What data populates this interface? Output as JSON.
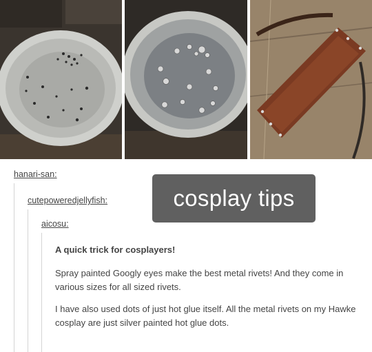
{
  "thread": {
    "user1": "hanari-san:",
    "user2": "cutepoweredjellyfish:",
    "user3": "aicosu:"
  },
  "overlay": {
    "text": "cosplay tips"
  },
  "post": {
    "heading": "A quick trick for cosplayers!",
    "paragraphs": [
      "Spray painted Googly eyes make the best metal rivets! And they come in various sizes for all sized rivets.",
      "I have also used dots of just hot glue itself. All the metal rivets on my Hawke cosplay are just silver painted hot glue dots."
    ]
  },
  "photos": [
    {
      "name": "googly-eyes-on-plate-photo"
    },
    {
      "name": "spray-painted-googly-eyes-photo"
    },
    {
      "name": "leather-quiver-with-rivets-photo"
    }
  ]
}
